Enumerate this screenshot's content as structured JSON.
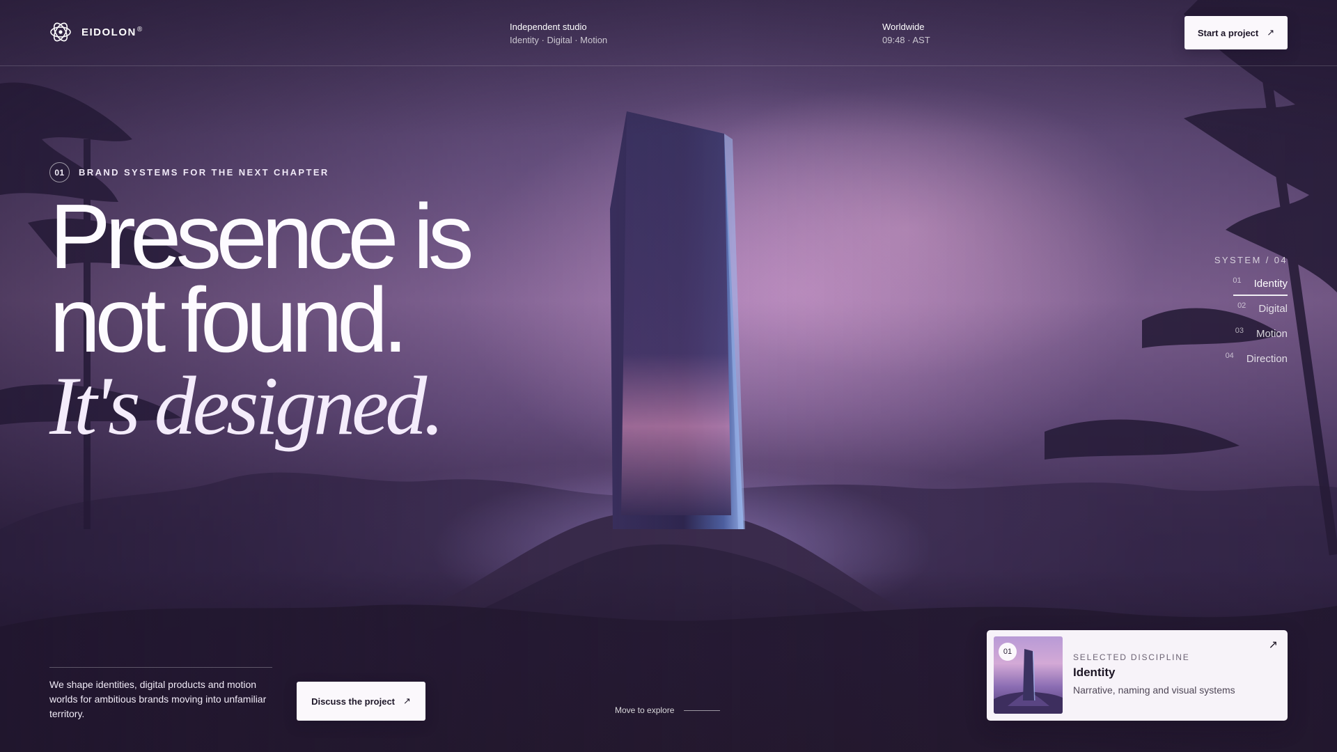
{
  "brand": {
    "name": "EIDOLON",
    "mark": "®"
  },
  "header": {
    "studio": {
      "title": "Independent studio",
      "subtitle": "Identity · Digital · Motion"
    },
    "location": {
      "title": "Worldwide",
      "time": "09:48 · AST"
    },
    "cta_label": "Start a project",
    "cta_icon": "arrow-up-right-icon"
  },
  "hero": {
    "eyebrow_num": "01",
    "eyebrow_text": "BRAND SYSTEMS FOR THE NEXT CHAPTER",
    "line1": "Presence is",
    "line2": "not found.",
    "line3": "It's designed."
  },
  "system": {
    "title": "SYSTEM / 04",
    "items": [
      {
        "num": "01",
        "label": "Identity",
        "active": true
      },
      {
        "num": "02",
        "label": "Digital",
        "active": false
      },
      {
        "num": "03",
        "label": "Motion",
        "active": false
      },
      {
        "num": "04",
        "label": "Direction",
        "active": false
      }
    ]
  },
  "intro": {
    "text": "We shape identities, digital products and motion worlds for ambitious brands moving into unfamiliar territory.",
    "cta_label": "Discuss the project"
  },
  "explore": {
    "label": "Move to explore"
  },
  "card": {
    "num": "01",
    "kicker": "SELECTED DISCIPLINE",
    "title": "Identity",
    "description": "Narrative, naming and visual systems"
  },
  "icons": {
    "arrow": "↗"
  },
  "colors": {
    "accent_light": "#fbf8fc",
    "sky_purple": "#8f6ea2",
    "text_dark": "#1c1524"
  }
}
